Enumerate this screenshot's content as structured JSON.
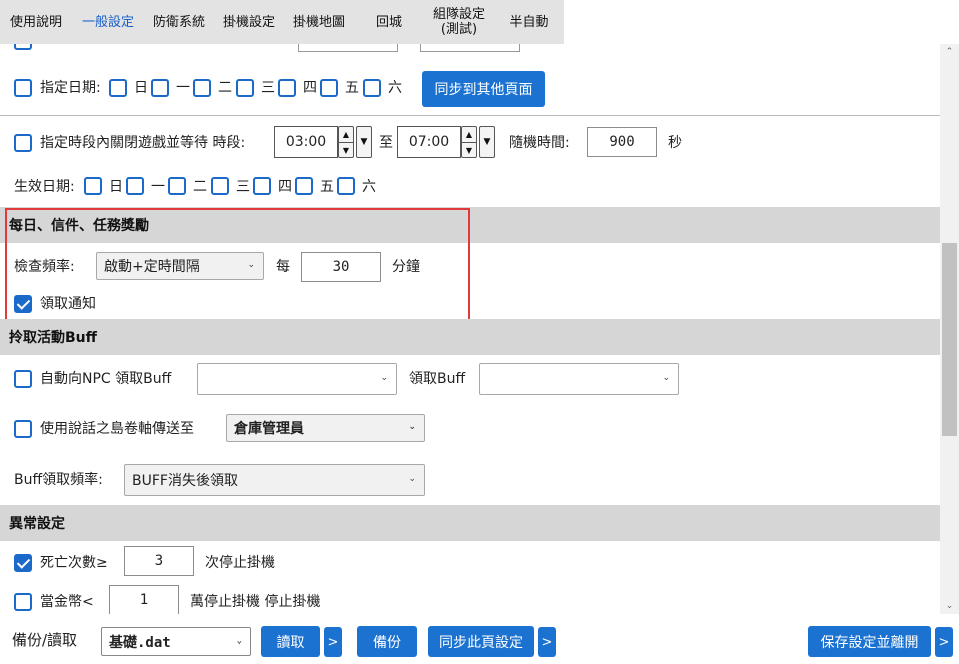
{
  "tabs": [
    {
      "label": "使用說明"
    },
    {
      "label": "一般設定",
      "active": true
    },
    {
      "label": "防衛系統"
    },
    {
      "label": "掛機設定"
    },
    {
      "label": "掛機地圖"
    },
    {
      "label": "回城"
    },
    {
      "label": "組隊設定\n(測試)"
    },
    {
      "label": "半自動"
    }
  ],
  "date_row": {
    "label": "指定日期:",
    "days": [
      "日",
      "一",
      "二",
      "三",
      "四",
      "五",
      "六"
    ],
    "sync_button": "同步到其他頁面"
  },
  "time_row": {
    "label": "指定時段內關閉遊戲並等待 時段:",
    "start": "03:00",
    "to": "至",
    "end": "07:00",
    "random_label": "隨機時間:",
    "random_value": "900",
    "unit": "秒"
  },
  "effective_row": {
    "label": "生效日期:",
    "days": [
      "日",
      "一",
      "二",
      "三",
      "四",
      "五",
      "六"
    ]
  },
  "daily_section": {
    "title": "每日、信件、任務獎勵",
    "freq_label": "檢查頻率:",
    "freq_value": "啟動+定時間隔",
    "every": "每",
    "minutes_value": "30",
    "minutes_unit": "分鐘",
    "notify_label": "領取通知"
  },
  "buff_section": {
    "title": "拎取活動Buff",
    "npc_label": "自動向NPC 領取Buff",
    "npc_value": "",
    "get_label": "領取Buff",
    "get_value": "",
    "scroll_label": "使用說話之島卷軸傳送至",
    "scroll_value": "倉庫管理員",
    "freq_label": "Buff領取頻率:",
    "freq_value": "BUFF消失後領取"
  },
  "abnormal_section": {
    "title": "異常設定",
    "death_label": "死亡次數≥",
    "death_value": "3",
    "death_suffix": "次停止掛機",
    "money_label": "當金幣<",
    "money_value": "1",
    "money_suffix": "萬停止掛機  停止掛機"
  },
  "bottom": {
    "backup_label": "備份/讀取",
    "file_value": "基礎.dat",
    "read_button": "讀取",
    "more": ">",
    "backup_button": "備份",
    "sync_button": "同步此頁設定",
    "save_button": "保存設定並離開"
  },
  "colors": {
    "accent": "#1b72d1",
    "checkbox": "#1b6ac9",
    "highlight": "#e03a3a",
    "section_bg": "#d6d6d6"
  }
}
